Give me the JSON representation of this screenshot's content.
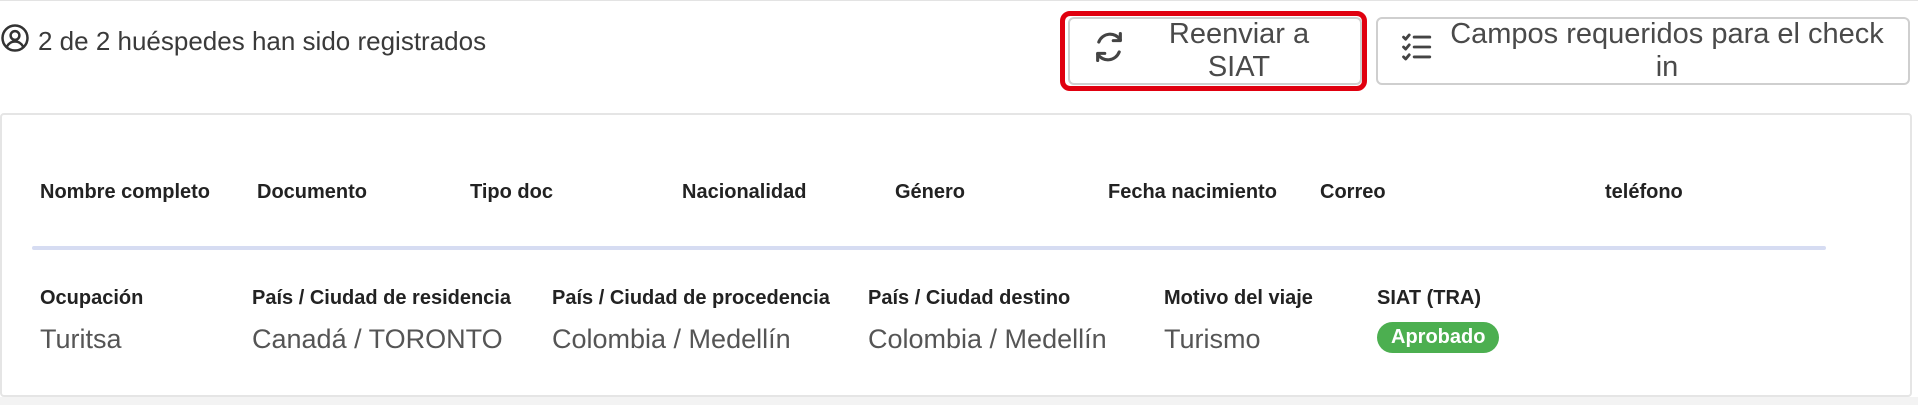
{
  "status": {
    "icon": "user-circle-icon",
    "text": "2 de 2 huéspedes han sido registrados"
  },
  "actions": {
    "resend": {
      "icon": "refresh-icon",
      "label": "Reenviar a SIAT"
    },
    "required_fields": {
      "icon": "checklist-icon",
      "label": "Campos requeridos para el check in"
    }
  },
  "table": {
    "columns": [
      "Nombre completo",
      "Documento",
      "Tipo doc",
      "Nacionalidad",
      "Género",
      "Fecha nacimiento",
      "Correo",
      "teléfono"
    ]
  },
  "details": {
    "occupation": {
      "label": "Ocupación",
      "value": "Turitsa"
    },
    "residence": {
      "label": "País / Ciudad de residencia",
      "value": "Canadá / TORONTO"
    },
    "origin": {
      "label": "País / Ciudad de procedencia",
      "value": "Colombia / Medellín"
    },
    "destination": {
      "label": "País / Ciudad destino",
      "value": "Colombia / Medellín"
    },
    "travel_reason": {
      "label": "Motivo del viaje",
      "value": "Turismo"
    },
    "siat": {
      "label": "SIAT (TRA)",
      "status": "Aprobado"
    }
  },
  "colors": {
    "highlight": "#e0000f",
    "approved_badge": "#4caf50",
    "divider": "#d6dcf2"
  }
}
